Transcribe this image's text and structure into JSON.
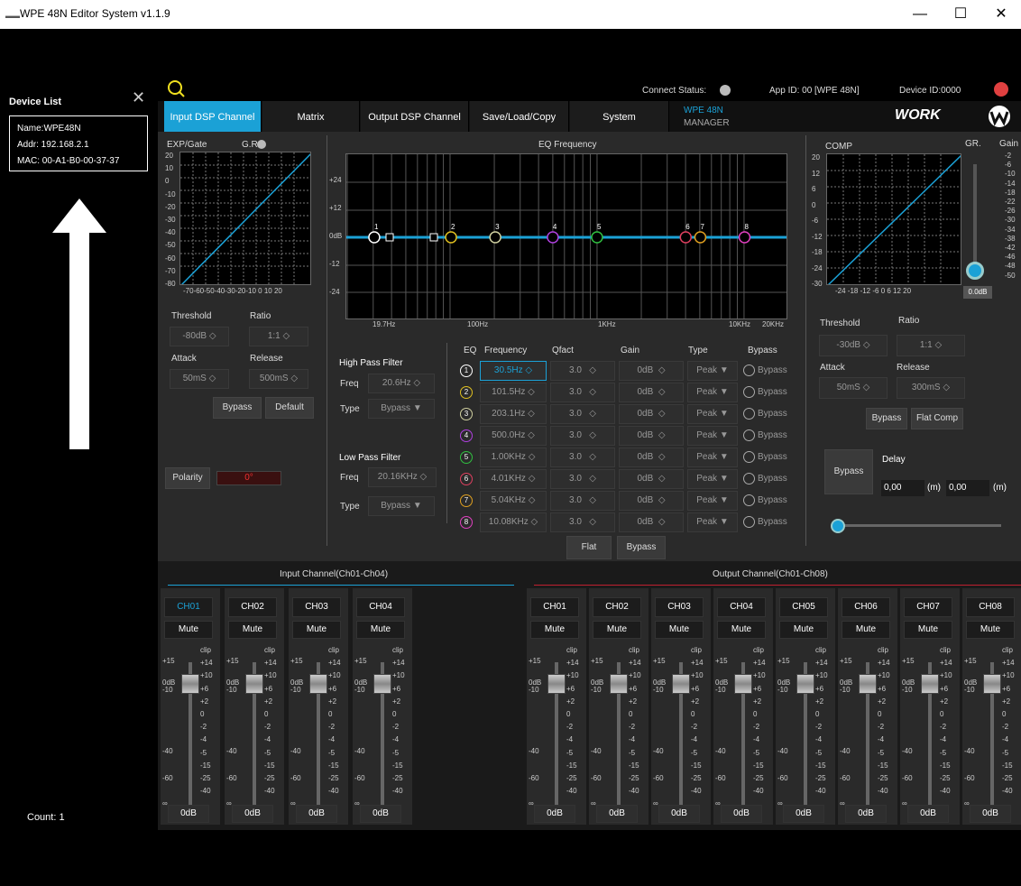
{
  "window": {
    "title": "WPE 48N Editor System v1.1.9",
    "logo": "WORK",
    "minimize": "—",
    "maximize": "☐",
    "close": "✕"
  },
  "sidebar": {
    "title": "Device List",
    "close": "✕",
    "device": {
      "name": "Name:WPE48N",
      "addr": "Addr: 192.168.2.1",
      "mac": "MAC: 00-A1-B0-00-37-37"
    },
    "count": "Count:  1"
  },
  "status": {
    "connect_label": "Connect  Status:",
    "app_id": "App ID:  00  [WPE 48N]",
    "device_id": "Device ID:0000"
  },
  "brand": {
    "model": "WPE 48N",
    "manager": "MANAGER",
    "logo": "WORK"
  },
  "tabs": [
    "Input DSP Channel",
    "Matrix",
    "Output DSP Channel",
    "Save/Load/Copy",
    "System"
  ],
  "gate": {
    "title": "EXP/Gate",
    "gr": "G.R.",
    "y_ticks": [
      "20",
      "10",
      "0",
      "-10",
      "-20",
      "-30",
      "-40",
      "-50",
      "-60",
      "-70",
      "-80"
    ],
    "x_ticks": "-70-60-50-40-30-20-10  0  10 20",
    "threshold_label": "Threshold",
    "ratio_label": "Ratio",
    "threshold": "-80dB",
    "ratio": "1:1",
    "attack_label": "Attack",
    "release_label": "Release",
    "attack": "50mS",
    "release": "500mS",
    "bypass": "Bypass",
    "default": "Default"
  },
  "polarity": {
    "label": "Polarity",
    "value": "0°"
  },
  "eq": {
    "title": "EQ Frequency",
    "y_ticks": [
      "+24",
      "+12",
      "0dB",
      "-12",
      "-24"
    ],
    "x_ticks": [
      "19.7Hz",
      "100Hz",
      "1KHz",
      "10KHz",
      "20KHz"
    ],
    "hpf": {
      "title": "High Pass Filter",
      "freq_label": "Freq",
      "freq": "20.6Hz",
      "type_label": "Type",
      "type": "Bypass"
    },
    "lpf": {
      "title": "Low Pass Filter",
      "freq_label": "Freq",
      "freq": "20.16KHz",
      "type_label": "Type",
      "type": "Bypass"
    },
    "headers": {
      "eq": "EQ",
      "freq": "Frequency",
      "q": "Qfact",
      "gain": "Gain",
      "type": "Type",
      "bypass": "Bypass"
    },
    "bands": [
      {
        "n": "1",
        "freq": "30.5Hz",
        "q": "3.0",
        "gain": "0dB",
        "type": "Peak",
        "bypass": "Bypass",
        "color": "#ffffff"
      },
      {
        "n": "2",
        "freq": "101.5Hz",
        "q": "3.0",
        "gain": "0dB",
        "type": "Peak",
        "bypass": "Bypass",
        "color": "#e0c020"
      },
      {
        "n": "3",
        "freq": "203.1Hz",
        "q": "3.0",
        "gain": "0dB",
        "type": "Peak",
        "bypass": "Bypass",
        "color": "#d0d0a0"
      },
      {
        "n": "4",
        "freq": "500.0Hz",
        "q": "3.0",
        "gain": "0dB",
        "type": "Peak",
        "bypass": "Bypass",
        "color": "#b040e0"
      },
      {
        "n": "5",
        "freq": "1.00KHz",
        "q": "3.0",
        "gain": "0dB",
        "type": "Peak",
        "bypass": "Bypass",
        "color": "#30c040"
      },
      {
        "n": "6",
        "freq": "4.01KHz",
        "q": "3.0",
        "gain": "0dB",
        "type": "Peak",
        "bypass": "Bypass",
        "color": "#e04060"
      },
      {
        "n": "7",
        "freq": "5.04KHz",
        "q": "3.0",
        "gain": "0dB",
        "type": "Peak",
        "bypass": "Bypass",
        "color": "#e0a020"
      },
      {
        "n": "8",
        "freq": "10.08KHz",
        "q": "3.0",
        "gain": "0dB",
        "type": "Peak",
        "bypass": "Bypass",
        "color": "#e040c0"
      }
    ],
    "flat": "Flat",
    "bypass": "Bypass"
  },
  "comp": {
    "title": "COMP",
    "gr": "GR.",
    "gain": "Gain",
    "y_ticks": [
      "20",
      "12",
      "6",
      "0",
      "-6",
      "-12",
      "-18",
      "-24",
      "-30"
    ],
    "x_ticks": "-24 -18  -12  -6   0    6   12 20",
    "gain_ticks": [
      "-2",
      "-6",
      "-10",
      "-14",
      "-18",
      "-22",
      "-26",
      "-30",
      "-34",
      "-38",
      "-42",
      "-46",
      "-48",
      "-50"
    ],
    "gain_value": "0.0dB",
    "threshold_label": "Threshold",
    "ratio_label": "Ratio",
    "threshold": "-30dB",
    "ratio": "1:1",
    "attack_label": "Attack",
    "release_label": "Release",
    "attack": "50mS",
    "release": "300mS",
    "bypass": "Bypass",
    "flat_comp": "Flat Comp"
  },
  "delay": {
    "bypass": "Bypass",
    "label": "Delay",
    "ms": "0,00",
    "m_unit": "(m)",
    "m": "0,00",
    "unit2": "(m)"
  },
  "input": {
    "title": "Input Channel(Ch01-Ch04)",
    "channels": [
      "CH01",
      "CH02",
      "CH03",
      "CH04"
    ]
  },
  "output": {
    "title": "Output Channel(Ch01-Ch08)",
    "channels": [
      "CH01",
      "CH02",
      "CH03",
      "CH04",
      "CH05",
      "CH06",
      "CH07",
      "CH08"
    ]
  },
  "strip": {
    "mute": "Mute",
    "gain": "0dB",
    "left_ticks": [
      "+15",
      "0dB",
      "-10",
      "-40",
      "-60",
      "∞"
    ],
    "right_ticks": [
      "clip",
      "+14",
      "+10",
      "+6",
      "+2",
      "0",
      "-2",
      "-4",
      "-5",
      "-15",
      "-25",
      "-40"
    ]
  },
  "colors": {
    "accent": "#1ba1d6",
    "eqline": "#1ba1d6",
    "input_line": "#1ba1d6",
    "output_line": "#c02030"
  }
}
